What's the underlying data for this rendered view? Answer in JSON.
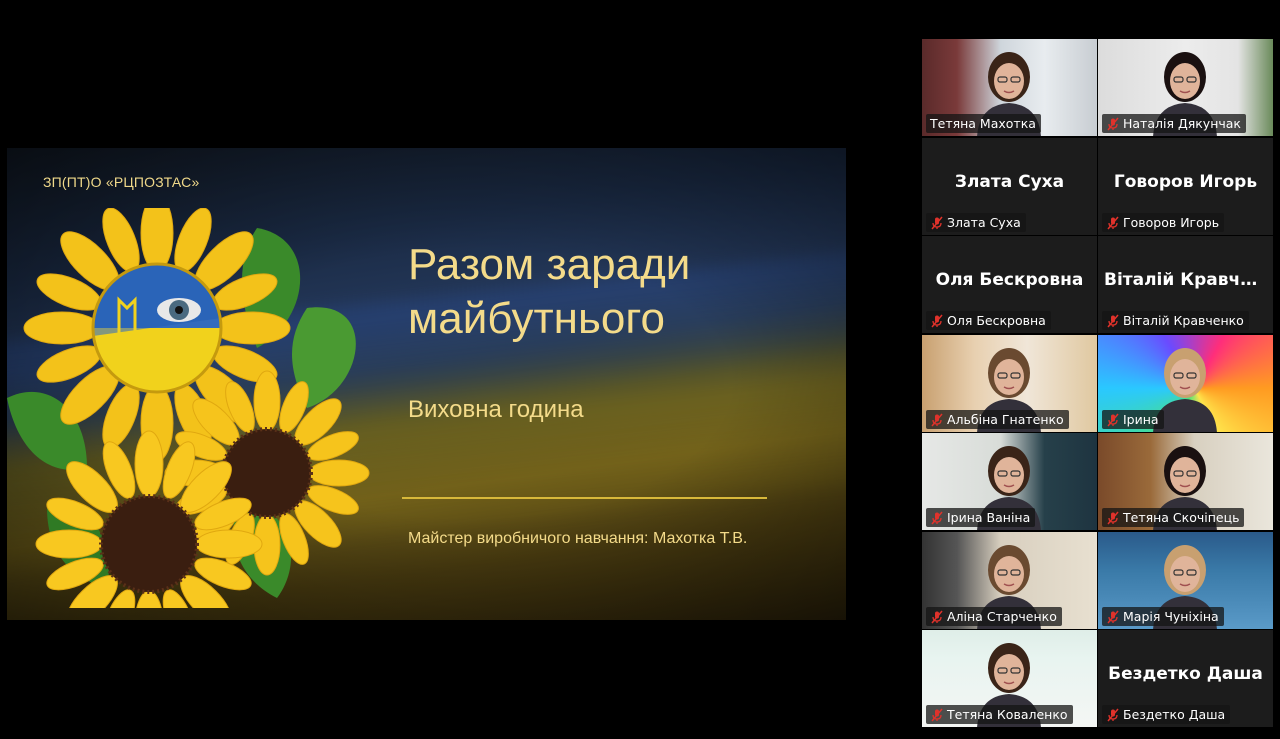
{
  "slide": {
    "org": "ЗП(ПТ)О «РЦПОЗТАС»",
    "title": "Разом заради\nмайбутнього",
    "subtitle": "Виховна година",
    "teacher": "Майстер виробничого навчання: Махотка Т.В."
  },
  "participants": [
    {
      "name": "Тетяна Махотка",
      "big": "",
      "video": true,
      "active": true,
      "muted": false,
      "scene": "window"
    },
    {
      "name": "Наталія Дякунчак",
      "big": "",
      "video": true,
      "active": false,
      "muted": true,
      "scene": "wall"
    },
    {
      "name": "Злата Суха",
      "big": "Злата Суха",
      "video": false,
      "muted": true
    },
    {
      "name": "Говоров Игорь",
      "big": "Говоров Игорь",
      "video": false,
      "muted": true
    },
    {
      "name": "Оля Бескровна",
      "big": "Оля Бескровна",
      "video": false,
      "muted": true
    },
    {
      "name": "Віталій Кравченко",
      "big": "Віталій  Кравче...",
      "video": false,
      "muted": true
    },
    {
      "name": "Альбіна Гнатенко",
      "big": "",
      "video": true,
      "muted": true,
      "scene": "curtain"
    },
    {
      "name": "Ірина",
      "big": "",
      "video": true,
      "muted": true,
      "scene": "rainbow"
    },
    {
      "name": "Ірина Ваніна",
      "big": "",
      "video": true,
      "muted": true,
      "scene": "shelf"
    },
    {
      "name": "Тетяна Скочіпець",
      "big": "",
      "video": true,
      "muted": true,
      "scene": "door"
    },
    {
      "name": "Аліна Старченко",
      "big": "",
      "video": true,
      "muted": true,
      "scene": "room"
    },
    {
      "name": "Марія Чуніхіна",
      "big": "",
      "video": true,
      "muted": true,
      "scene": "banner"
    },
    {
      "name": "Тетяна  Коваленко",
      "big": "",
      "video": true,
      "muted": true,
      "scene": "poster"
    },
    {
      "name": "Бездетко Даша",
      "big": "Бездетко Даша",
      "video": false,
      "muted": true
    }
  ],
  "colors": {
    "active_border": "#2fd36b",
    "muted_icon": "#e0322b",
    "slide_text": "#f4db8a"
  }
}
